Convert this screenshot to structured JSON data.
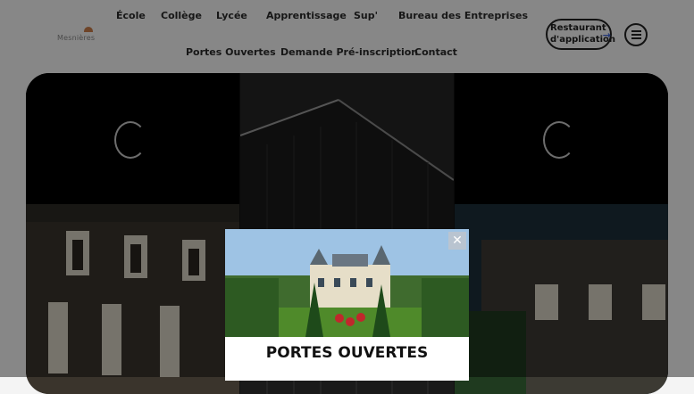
{
  "brand": {
    "logo_text": "Mesnières"
  },
  "nav": {
    "row1": [
      "École",
      "Collège",
      "Lycée",
      "Apprentissage",
      "Sup'",
      "Bureau des Entreprises"
    ],
    "row2": [
      "Portes Ouvertes",
      "Demande Pré-inscription",
      "Contact"
    ]
  },
  "cta": {
    "line1": "Restaurant",
    "line2": "d'application",
    "arrow": "→"
  },
  "menu": {
    "icon": "hamburger-icon"
  },
  "modal": {
    "title": "PORTES OUVERTES",
    "close_label": "✕"
  },
  "colors": {
    "accent": "#3f63d6",
    "dark": "#222222"
  }
}
